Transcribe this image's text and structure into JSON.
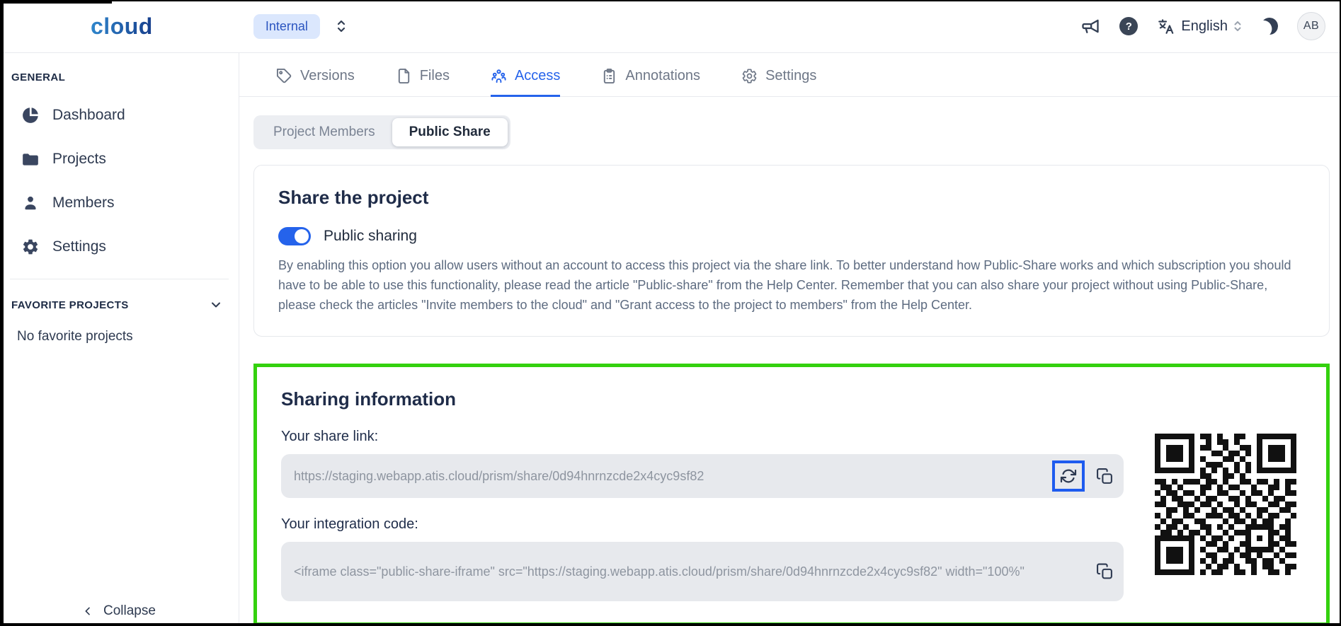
{
  "header": {
    "logo": "cloud",
    "workspace_badge": "Internal",
    "language": "English",
    "avatar_initials": "AB",
    "help_glyph": "?"
  },
  "sidebar": {
    "general": {
      "title": "GENERAL",
      "items": [
        {
          "label": "Dashboard",
          "icon": "pie-chart-icon"
        },
        {
          "label": "Projects",
          "icon": "folder-icon"
        },
        {
          "label": "Members",
          "icon": "person-icon"
        },
        {
          "label": "Settings",
          "icon": "gear-icon"
        }
      ]
    },
    "favorites": {
      "title": "FAVORITE PROJECTS",
      "empty_text": "No favorite projects"
    },
    "collapse_label": "Collapse"
  },
  "tabs": [
    {
      "label": "Versions",
      "icon": "tag-icon",
      "active": false
    },
    {
      "label": "Files",
      "icon": "file-icon",
      "active": false
    },
    {
      "label": "Access",
      "icon": "people-icon",
      "active": true
    },
    {
      "label": "Annotations",
      "icon": "clipboard-icon",
      "active": false
    },
    {
      "label": "Settings",
      "icon": "gear-icon",
      "active": false
    }
  ],
  "subtabs": [
    {
      "label": "Project Members",
      "active": false
    },
    {
      "label": "Public Share",
      "active": true
    }
  ],
  "share_card": {
    "title": "Share the project",
    "toggle_label": "Public sharing",
    "toggle_on": true,
    "description": "By enabling this option you allow users without an account to access this project via the share link. To better understand how Public-Share works and which subscription you should have to be able to use this functionality, please read the article \"Public-share\" from the Help Center. Remember that you can also share your project without using Public-Share, please check the articles \"Invite members to the cloud\" and \"Grant access to the project to members\" from the Help Center."
  },
  "sharing_info": {
    "title": "Sharing information",
    "share_link_label": "Your share link:",
    "share_link_value": "https://staging.webapp.atis.cloud/prism/share/0d94hnrnzcde2x4cyc9sf82",
    "integration_label": "Your integration code:",
    "integration_value": "<iframe class=\"public-share-iframe\" src=\"https://staging.webapp.atis.cloud/prism/share/0d94hnrnzcde2x4cyc9sf82\" width=\"100%\"",
    "qr_matrix": [
      "1111111011010011001111111",
      "1000001001011010001000001",
      "1011101011001001101011101",
      "1011101000110110101011101",
      "1011101010001101001011101",
      "1000001001110010101000001",
      "1111111010101010101111111",
      "0000000011001101000000000",
      "1101011101101001101101011",
      "0110100011010110010011010",
      "1011011010011001011010011",
      "0101100101100110100101100",
      "1100111011010010110011011",
      "0011010100101101001100110",
      "1010011001110110101011001",
      "0101100110001011010110010",
      "1011010011010100111110110",
      "0110101101001011100011010",
      "1111111010110100101010110",
      "1000001001101001100011011",
      "1011101010011010111110100",
      "1011101001100101101001011",
      "1011101010101100110110100",
      "1000001001011010010110011",
      "1111111010110011010011010"
    ]
  },
  "colors": {
    "accent_blue": "#2563eb",
    "badge_bg": "#dbe7fd",
    "highlight_green": "#34d10e",
    "highlight_blue": "#1e5bef",
    "input_bg": "#e7e9ed"
  }
}
